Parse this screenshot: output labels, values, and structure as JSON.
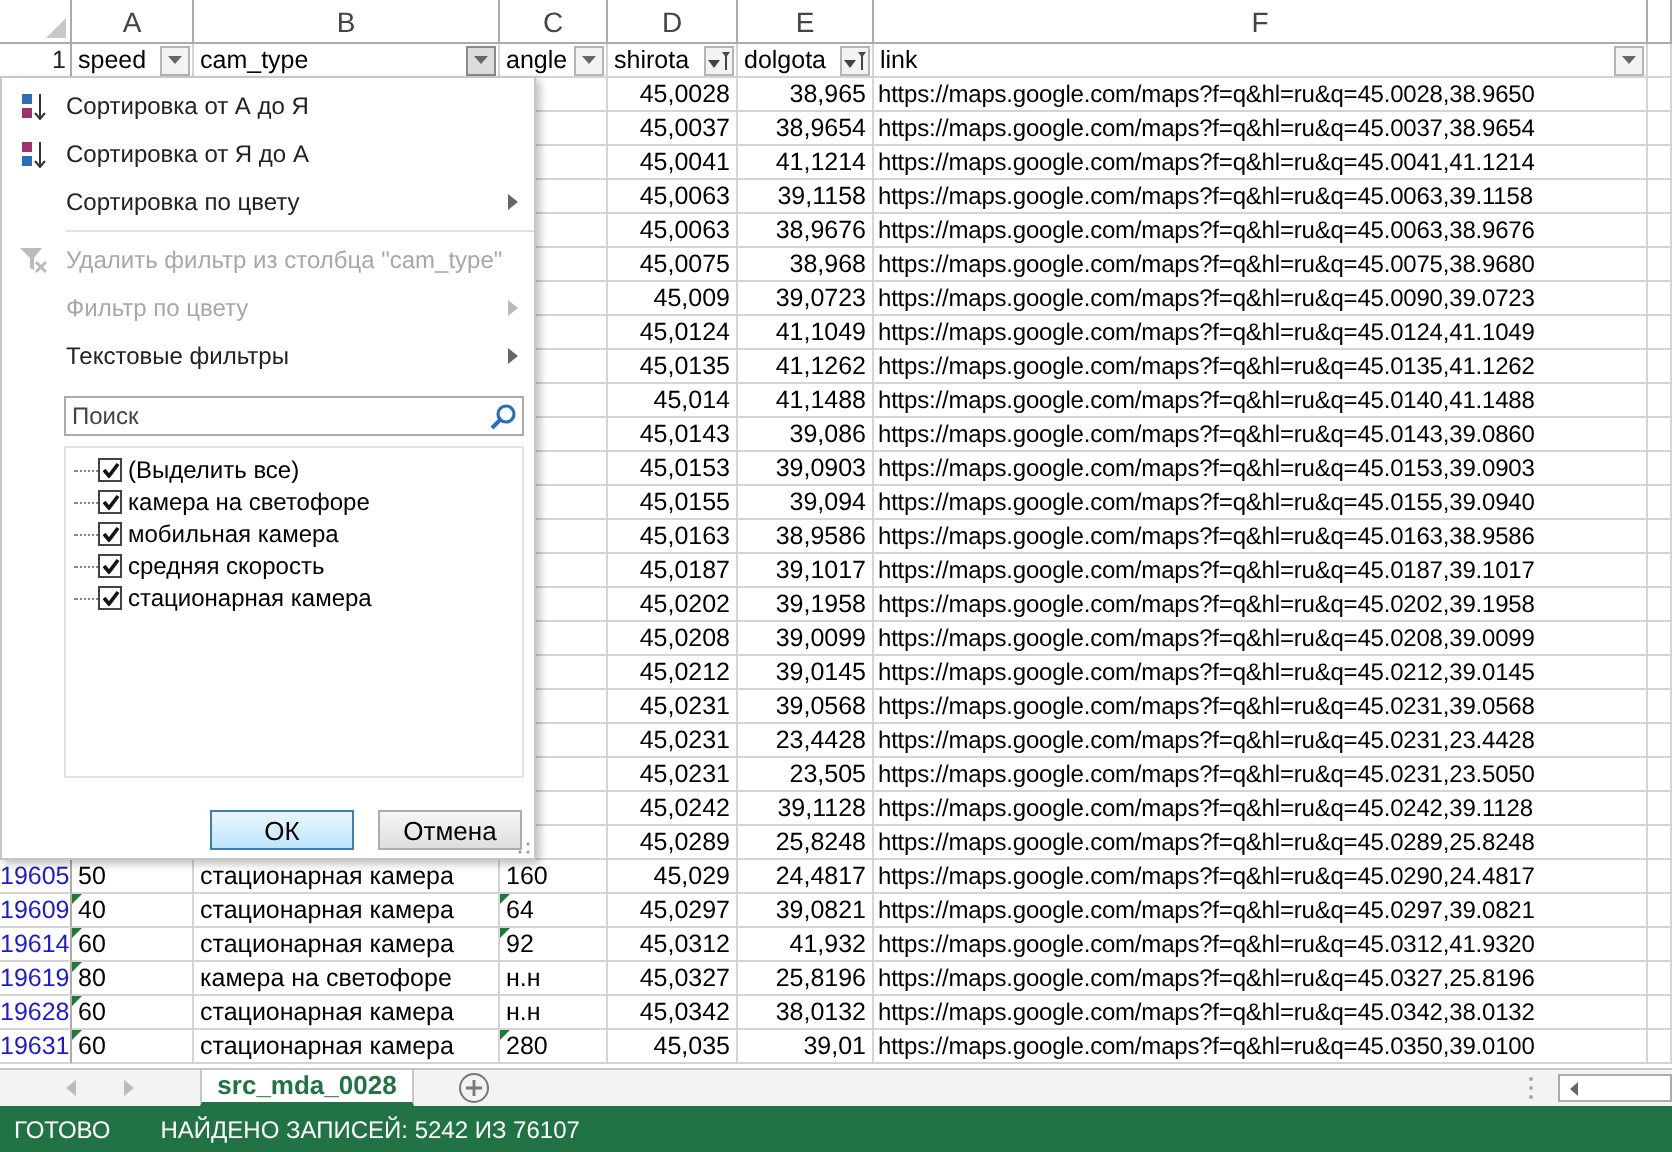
{
  "columns": [
    {
      "letter": "A"
    },
    {
      "letter": "B"
    },
    {
      "letter": "C"
    },
    {
      "letter": "D"
    },
    {
      "letter": "E"
    },
    {
      "letter": "F"
    }
  ],
  "header_row": {
    "number": "1",
    "cells": [
      {
        "text": "speed",
        "filtered": false,
        "open": false
      },
      {
        "text": "cam_type",
        "filtered": false,
        "open": true
      },
      {
        "text": "angle",
        "filtered": false,
        "open": false
      },
      {
        "text": "shirota",
        "filtered": true,
        "open": false
      },
      {
        "text": "dolgota",
        "filtered": true,
        "open": false
      },
      {
        "text": "link",
        "filtered": false,
        "open": false
      }
    ]
  },
  "rows": [
    {
      "shirota": "45,0028",
      "dolgota": "38,965",
      "link": "https://maps.google.com/maps?f=q&hl=ru&q=45.0028,38.9650"
    },
    {
      "shirota": "45,0037",
      "dolgota": "38,9654",
      "link": "https://maps.google.com/maps?f=q&hl=ru&q=45.0037,38.9654"
    },
    {
      "shirota": "45,0041",
      "dolgota": "41,1214",
      "link": "https://maps.google.com/maps?f=q&hl=ru&q=45.0041,41.1214"
    },
    {
      "shirota": "45,0063",
      "dolgota": "39,1158",
      "link": "https://maps.google.com/maps?f=q&hl=ru&q=45.0063,39.1158"
    },
    {
      "shirota": "45,0063",
      "dolgota": "38,9676",
      "link": "https://maps.google.com/maps?f=q&hl=ru&q=45.0063,38.9676"
    },
    {
      "shirota": "45,0075",
      "dolgota": "38,968",
      "link": "https://maps.google.com/maps?f=q&hl=ru&q=45.0075,38.9680"
    },
    {
      "shirota": "45,009",
      "dolgota": "39,0723",
      "link": "https://maps.google.com/maps?f=q&hl=ru&q=45.0090,39.0723"
    },
    {
      "shirota": "45,0124",
      "dolgota": "41,1049",
      "link": "https://maps.google.com/maps?f=q&hl=ru&q=45.0124,41.1049"
    },
    {
      "shirota": "45,0135",
      "dolgota": "41,1262",
      "link": "https://maps.google.com/maps?f=q&hl=ru&q=45.0135,41.1262"
    },
    {
      "shirota": "45,014",
      "dolgota": "41,1488",
      "link": "https://maps.google.com/maps?f=q&hl=ru&q=45.0140,41.1488"
    },
    {
      "shirota": "45,0143",
      "dolgota": "39,086",
      "link": "https://maps.google.com/maps?f=q&hl=ru&q=45.0143,39.0860"
    },
    {
      "shirota": "45,0153",
      "dolgota": "39,0903",
      "link": "https://maps.google.com/maps?f=q&hl=ru&q=45.0153,39.0903"
    },
    {
      "shirota": "45,0155",
      "dolgota": "39,094",
      "link": "https://maps.google.com/maps?f=q&hl=ru&q=45.0155,39.0940"
    },
    {
      "shirota": "45,0163",
      "dolgota": "38,9586",
      "link": "https://maps.google.com/maps?f=q&hl=ru&q=45.0163,38.9586"
    },
    {
      "shirota": "45,0187",
      "dolgota": "39,1017",
      "link": "https://maps.google.com/maps?f=q&hl=ru&q=45.0187,39.1017"
    },
    {
      "shirota": "45,0202",
      "dolgota": "39,1958",
      "link": "https://maps.google.com/maps?f=q&hl=ru&q=45.0202,39.1958"
    },
    {
      "shirota": "45,0208",
      "dolgota": "39,0099",
      "link": "https://maps.google.com/maps?f=q&hl=ru&q=45.0208,39.0099"
    },
    {
      "shirota": "45,0212",
      "dolgota": "39,0145",
      "link": "https://maps.google.com/maps?f=q&hl=ru&q=45.0212,39.0145"
    },
    {
      "shirota": "45,0231",
      "dolgota": "39,0568",
      "link": "https://maps.google.com/maps?f=q&hl=ru&q=45.0231,39.0568"
    },
    {
      "shirota": "45,0231",
      "dolgota": "23,4428",
      "link": "https://maps.google.com/maps?f=q&hl=ru&q=45.0231,23.4428"
    },
    {
      "shirota": "45,0231",
      "dolgota": "23,505",
      "link": "https://maps.google.com/maps?f=q&hl=ru&q=45.0231,23.5050"
    },
    {
      "shirota": "45,0242",
      "dolgota": "39,1128",
      "link": "https://maps.google.com/maps?f=q&hl=ru&q=45.0242,39.1128"
    },
    {
      "shirota": "45,0289",
      "dolgota": "25,8248",
      "link": "https://maps.google.com/maps?f=q&hl=ru&q=45.0289,25.8248"
    },
    {
      "number": "19605",
      "speed": "50",
      "speed_flag": false,
      "cam_type": "стационарная камера",
      "angle": "160",
      "angle_flag": false,
      "shirota": "45,029",
      "dolgota": "24,4817",
      "link": "https://maps.google.com/maps?f=q&hl=ru&q=45.0290,24.4817"
    },
    {
      "number": "19609",
      "speed": "40",
      "speed_flag": true,
      "cam_type": "стационарная камера",
      "angle": "64",
      "angle_flag": true,
      "shirota": "45,0297",
      "dolgota": "39,0821",
      "link": "https://maps.google.com/maps?f=q&hl=ru&q=45.0297,39.0821"
    },
    {
      "number": "19614",
      "speed": "60",
      "speed_flag": true,
      "cam_type": "стационарная камера",
      "angle": "92",
      "angle_flag": true,
      "shirota": "45,0312",
      "dolgota": "41,932",
      "link": "https://maps.google.com/maps?f=q&hl=ru&q=45.0312,41.9320"
    },
    {
      "number": "19619",
      "speed": "80",
      "speed_flag": true,
      "cam_type": "камера на светофоре",
      "angle": "н.н",
      "angle_flag": false,
      "shirota": "45,0327",
      "dolgota": "25,8196",
      "link": "https://maps.google.com/maps?f=q&hl=ru&q=45.0327,25.8196"
    },
    {
      "number": "19628",
      "speed": "60",
      "speed_flag": true,
      "cam_type": "стационарная камера",
      "angle": "н.н",
      "angle_flag": false,
      "shirota": "45,0342",
      "dolgota": "38,0132",
      "link": "https://maps.google.com/maps?f=q&hl=ru&q=45.0342,38.0132"
    },
    {
      "number": "19631",
      "speed": "60",
      "speed_flag": true,
      "cam_type": "стационарная камера",
      "angle": "280",
      "angle_flag": true,
      "shirota": "45,035",
      "dolgota": "39,01",
      "link": "https://maps.google.com/maps?f=q&hl=ru&q=45.0350,39.0100"
    }
  ],
  "filter_menu": {
    "items": [
      {
        "kind": "sort-asc",
        "label": "Сортировка от А до Я",
        "disabled": false,
        "submenu": false
      },
      {
        "kind": "sort-desc",
        "label": "Сортировка от Я до А",
        "disabled": false,
        "submenu": false
      },
      {
        "kind": "plain",
        "label": "Сортировка по цвету",
        "disabled": false,
        "submenu": true
      },
      {
        "kind": "separator"
      },
      {
        "kind": "clear-filter",
        "label": "Удалить фильтр из столбца \"cam_type\"",
        "disabled": true,
        "submenu": false
      },
      {
        "kind": "plain",
        "label": "Фильтр по цвету",
        "disabled": true,
        "submenu": true
      },
      {
        "kind": "plain",
        "label": "Текстовые фильтры",
        "disabled": false,
        "submenu": true
      }
    ],
    "search": {
      "placeholder": "Поиск"
    },
    "values": [
      {
        "label": "(Выделить все)",
        "checked": true
      },
      {
        "label": "камера на светофоре",
        "checked": true
      },
      {
        "label": "мобильная камера",
        "checked": true
      },
      {
        "label": "средняя скорость",
        "checked": true
      },
      {
        "label": "стационарная камера",
        "checked": true
      }
    ],
    "buttons": [
      {
        "label": "ОК",
        "default": true
      },
      {
        "label": "Отмена",
        "default": false
      }
    ]
  },
  "sheet_tabs": [
    {
      "label": "src_mda_0028",
      "selected": true
    }
  ],
  "status_bar": {
    "state": "ГОТОВО",
    "records": "НАЙДЕНО ЗАПИСЕЙ: 5242 ИЗ 76107"
  }
}
